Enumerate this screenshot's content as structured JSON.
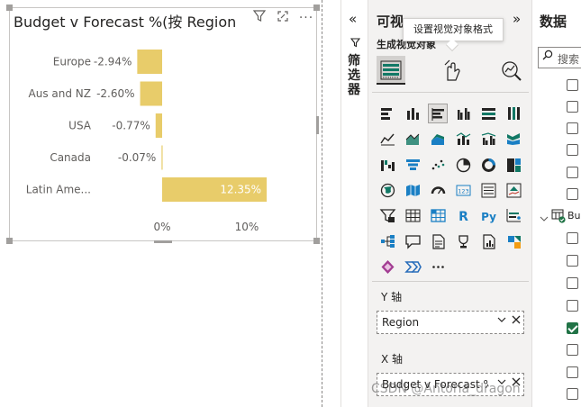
{
  "visual": {
    "title": "Budget v Forecast %(按 Region",
    "header_icons": [
      "filter-icon",
      "focus-mode-icon",
      "more-options-icon"
    ]
  },
  "chart_data": {
    "type": "bar",
    "orientation": "horizontal",
    "categories": [
      "Europe",
      "Aus and NZ",
      "USA",
      "Canada",
      "Latin Ame..."
    ],
    "values": [
      -2.94,
      -2.6,
      -0.77,
      -0.07,
      12.35
    ],
    "value_labels": [
      "-2.94%",
      "-2.60%",
      "-0.77%",
      "-0.07%",
      "12.35%"
    ],
    "x_ticks": [
      "0%",
      "10%"
    ],
    "xlim": [
      -4.5,
      14
    ],
    "bar_color": "#E8CC6A",
    "grid": false
  },
  "filters_pane": {
    "label": "筛选器"
  },
  "viz_pane": {
    "title": "可视",
    "subtitle": "生成视觉对象",
    "tooltip": "设置视觉对象格式",
    "modes": [
      "build-visual-icon",
      "format-visual-icon",
      "analytics-icon"
    ],
    "gallery_icons": [
      "stacked-bar-chart-icon",
      "stacked-column-chart-icon",
      "clustered-bar-chart-icon",
      "clustered-column-chart-icon",
      "100-stacked-bar-chart-icon",
      "100-stacked-column-chart-icon",
      "line-chart-icon",
      "area-chart-icon",
      "stacked-area-chart-icon",
      "line-and-column-chart-icon",
      "line-and-clustered-column-chart-icon",
      "ribbon-chart-icon",
      "waterfall-chart-icon",
      "funnel-chart-icon",
      "scatter-chart-icon",
      "pie-chart-icon",
      "donut-chart-icon",
      "treemap-icon",
      "map-icon",
      "filled-map-icon",
      "gauge-icon",
      "card-icon",
      "multi-row-card-icon",
      "kpi-icon",
      "slicer-icon",
      "table-icon",
      "matrix-icon",
      "r-visual-icon",
      "python-visual-icon",
      "key-influencers-icon",
      "decomposition-tree-icon",
      "qa-icon",
      "smart-narrative-icon",
      "metrics-icon",
      "paginated-report-icon",
      "power-automate-icon",
      "power-apps-icon",
      "arcgis-icon",
      "more-visuals-icon"
    ],
    "more_label": "···",
    "y_axis": {
      "label": "Y 轴",
      "field": "Region"
    },
    "x_axis": {
      "label": "X 轴",
      "field": "Budget v Forecast %"
    }
  },
  "data_pane": {
    "title": "数据",
    "search_placeholder": "搜索",
    "table_name": "Bu",
    "checkbox_states": [
      false,
      false,
      false,
      false,
      false,
      false,
      false,
      false,
      false,
      false,
      true,
      false,
      false,
      false,
      false
    ]
  },
  "watermark": "CSDN @Antoria_dragon"
}
